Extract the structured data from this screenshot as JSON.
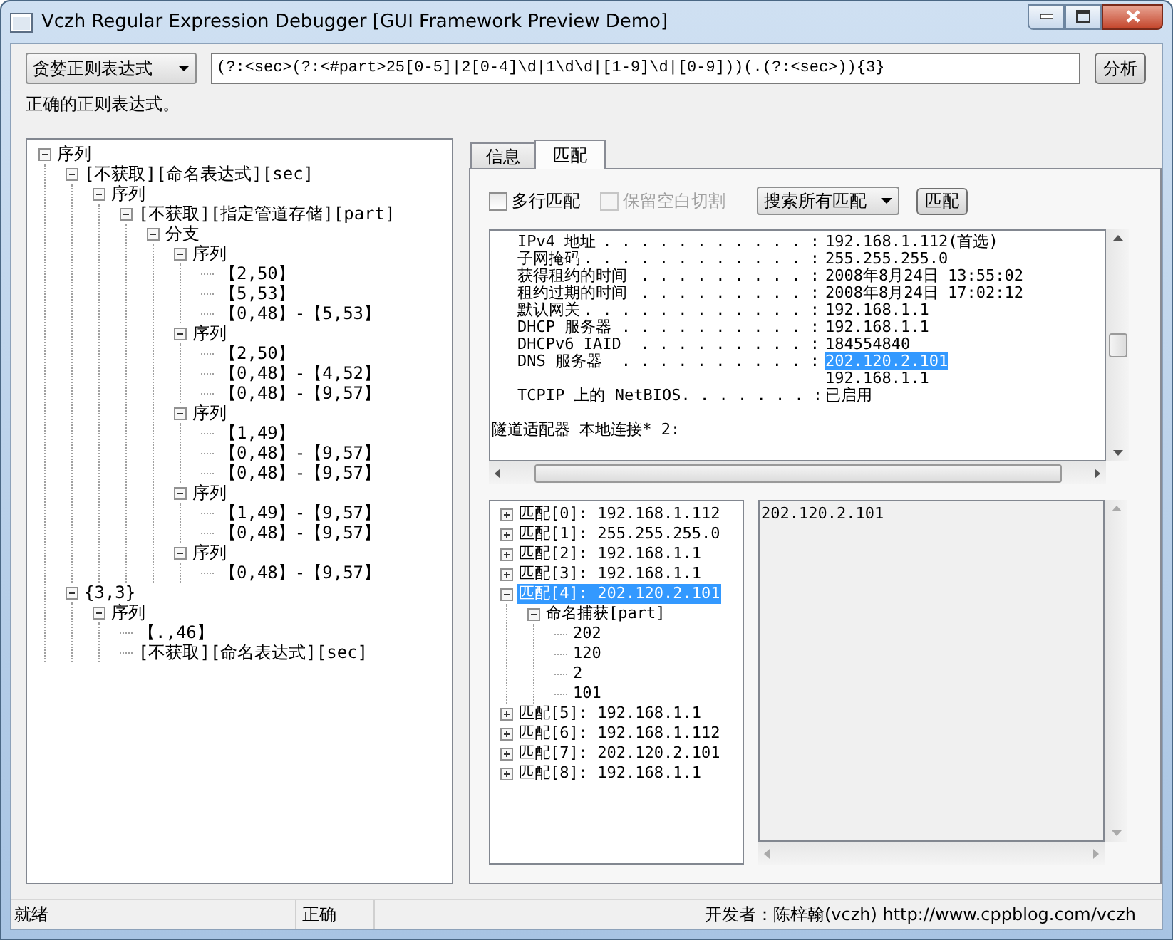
{
  "window": {
    "title": "Vczh Regular Expression Debugger [GUI Framework Preview Demo]"
  },
  "toolbar": {
    "mode": "贪婪正则表达式",
    "expression": "(?:<sec>(?:<#part>25[0-5]|2[0-4]\\d|1\\d\\d|[1-9]\\d|[0-9]))(.(?:<sec>)){3}",
    "button": "分析"
  },
  "message": "正确的正则表达式。",
  "syntax_tree": [
    {
      "label": "序列",
      "expanded": true,
      "children": [
        {
          "label": "[不获取][命名表达式][sec]",
          "expanded": true,
          "children": [
            {
              "label": "序列",
              "expanded": true,
              "children": [
                {
                  "label": "[不获取][指定管道存储][part]",
                  "expanded": true,
                  "children": [
                    {
                      "label": "分支",
                      "expanded": true,
                      "children": [
                        {
                          "label": "序列",
                          "expanded": true,
                          "children": [
                            {
                              "label": "【2,50】"
                            },
                            {
                              "label": "【5,53】"
                            },
                            {
                              "label": "【0,48】-【5,53】"
                            }
                          ]
                        },
                        {
                          "label": "序列",
                          "expanded": true,
                          "children": [
                            {
                              "label": "【2,50】"
                            },
                            {
                              "label": "【0,48】-【4,52】"
                            },
                            {
                              "label": "【0,48】-【9,57】"
                            }
                          ]
                        },
                        {
                          "label": "序列",
                          "expanded": true,
                          "children": [
                            {
                              "label": "【1,49】"
                            },
                            {
                              "label": "【0,48】-【9,57】"
                            },
                            {
                              "label": "【0,48】-【9,57】"
                            }
                          ]
                        },
                        {
                          "label": "序列",
                          "expanded": true,
                          "children": [
                            {
                              "label": "【1,49】-【9,57】"
                            },
                            {
                              "label": "【0,48】-【9,57】"
                            }
                          ]
                        },
                        {
                          "label": "序列",
                          "expanded": true,
                          "children": [
                            {
                              "label": "【0,48】-【9,57】"
                            }
                          ]
                        }
                      ]
                    }
                  ]
                }
              ]
            }
          ]
        },
        {
          "label": "{3,3}",
          "expanded": true,
          "children": [
            {
              "label": "序列",
              "expanded": true,
              "children": [
                {
                  "label": "【.,46】"
                },
                {
                  "label": "[不获取][命名表达式][sec]"
                }
              ]
            }
          ]
        }
      ]
    }
  ],
  "tabs": [
    {
      "label": "信息",
      "selected": false
    },
    {
      "label": "匹配",
      "selected": true
    }
  ],
  "match_panel": {
    "options": [
      {
        "label": "多行匹配",
        "checked": false,
        "disabled": false
      },
      {
        "label": "保留空白切割",
        "checked": false,
        "disabled": true
      }
    ],
    "search_mode": "搜索所有匹配",
    "button": "匹配",
    "input_lines": [
      {
        "kind": "entry",
        "name": "IPv4 地址",
        "leader": ". . . . . . . . . . . :",
        "value": "192.168.1.112(首选)",
        "selected": false
      },
      {
        "kind": "entry",
        "name": "子网掩码",
        "leader": ". . . . . . . . . . . . :",
        "value": "255.255.255.0",
        "selected": false
      },
      {
        "kind": "entry",
        "name": "获得租约的时间",
        "leader": ". . . . . . . . . :",
        "value": "2008年8月24日 13:55:02",
        "selected": false
      },
      {
        "kind": "entry",
        "name": "租约过期的时间",
        "leader": ". . . . . . . . . :",
        "value": "2008年8月24日 17:02:12",
        "selected": false
      },
      {
        "kind": "entry",
        "name": "默认网关",
        "leader": ". . . . . . . . . . . . :",
        "value": "192.168.1.1",
        "selected": false
      },
      {
        "kind": "entry",
        "name": "DHCP 服务器",
        "leader": ". . . . . . . . . . :",
        "value": "192.168.1.1",
        "selected": false
      },
      {
        "kind": "entry",
        "name": "DHCPv6 IAID",
        "leader": ". . . . . . . . . :",
        "value": "184554840",
        "selected": false
      },
      {
        "kind": "entry",
        "name": "DNS 服务器",
        "leader": ". . . . . . . . . . :",
        "value": "202.120.2.101",
        "selected": true
      },
      {
        "kind": "entry",
        "value": "192.168.1.1",
        "selected": false
      },
      {
        "kind": "entry",
        "name": "TCPIP 上的 NetBIOS",
        "leader": ". . . . . . . :",
        "value": "已启用",
        "selected": false
      },
      {
        "kind": "heading",
        "text": "隧道适配器 本地连接* 2:"
      }
    ],
    "matches": [
      {
        "label": "匹配[0]: 192.168.1.112",
        "expanded": false,
        "selected": false
      },
      {
        "label": "匹配[1]: 255.255.255.0",
        "expanded": false,
        "selected": false
      },
      {
        "label": "匹配[2]: 192.168.1.1",
        "expanded": false,
        "selected": false
      },
      {
        "label": "匹配[3]: 192.168.1.1",
        "expanded": false,
        "selected": false
      },
      {
        "label": "匹配[4]: 202.120.2.101",
        "expanded": true,
        "selected": true,
        "children": [
          {
            "label": "命名捕获[part]",
            "expanded": true,
            "selected": false,
            "children": [
              {
                "label": "202",
                "selected": false
              },
              {
                "label": "120",
                "selected": false
              },
              {
                "label": "2",
                "selected": false
              },
              {
                "label": "101",
                "selected": false
              }
            ]
          }
        ]
      },
      {
        "label": "匹配[5]: 192.168.1.1",
        "expanded": false,
        "selected": false
      },
      {
        "label": "匹配[6]: 192.168.1.112",
        "expanded": false,
        "selected": false
      },
      {
        "label": "匹配[7]: 202.120.2.101",
        "expanded": false,
        "selected": false
      },
      {
        "label": "匹配[8]: 192.168.1.1",
        "expanded": false,
        "selected": false
      }
    ],
    "match_text": "202.120.2.101"
  },
  "status_bar": [
    "就绪",
    "正确",
    "开发者：陈梓翰(vczh) http://www.cppblog.com/vczh"
  ]
}
